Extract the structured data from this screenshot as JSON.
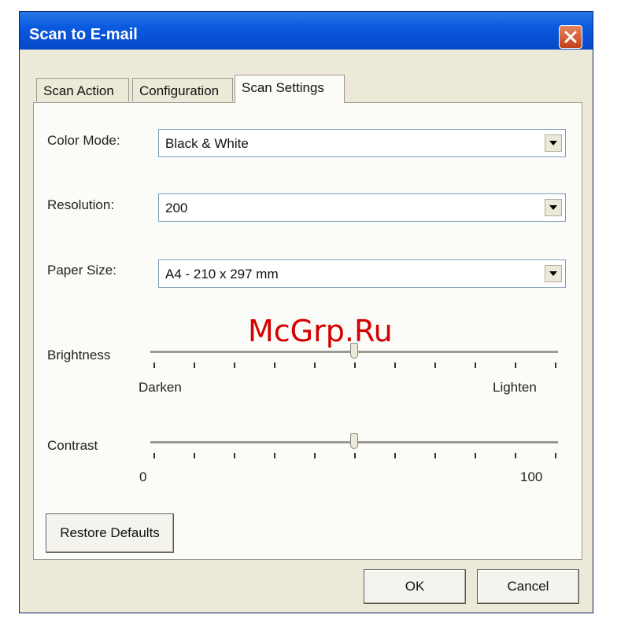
{
  "window": {
    "title": "Scan to E-mail"
  },
  "tabs": [
    {
      "label": "Scan Action"
    },
    {
      "label": "Configuration"
    },
    {
      "label": "Scan Settings"
    }
  ],
  "color_mode": {
    "label": "Color Mode:",
    "value": "Black & White"
  },
  "resolution": {
    "label": "Resolution:",
    "value": "200"
  },
  "paper_size": {
    "label": "Paper Size:",
    "value": "A4 - 210 x 297 mm"
  },
  "brightness": {
    "label": "Brightness",
    "min_label": "Darken",
    "max_label": "Lighten",
    "level": 0.5
  },
  "contrast": {
    "label": "Contrast",
    "min_label": "0",
    "max_label": "100",
    "level": 0.5
  },
  "buttons": {
    "restore_defaults": "Restore Defaults",
    "ok": "OK",
    "cancel": "Cancel"
  },
  "watermark": "McGrp.Ru",
  "colors": {
    "title_bar": "#0a5ae0",
    "face": "#ece9d8",
    "watermark": "#d40000"
  }
}
